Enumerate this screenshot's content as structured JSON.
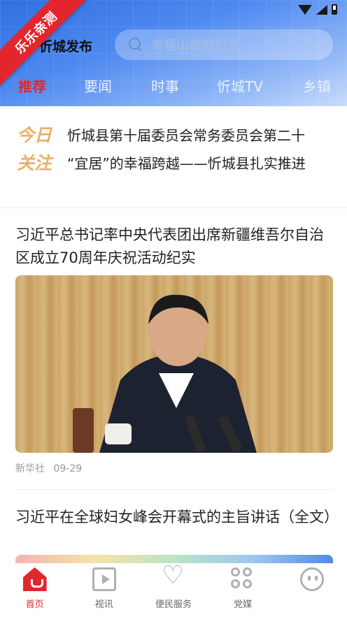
{
  "header": {
    "ribbon": "乐乐亲测",
    "logo_text": "忻城发布",
    "search_placeholder": "幸福山歌唱起来"
  },
  "tabs": [
    "推荐",
    "要闻",
    "时事",
    "忻城TV",
    "乡镇"
  ],
  "active_tab": "推荐",
  "today_focus": {
    "label_line1": "今日",
    "label_line2": "关注",
    "items": [
      "忻城县第十届委员会常务委员会第二十",
      "“宜居”的幸福跨越——忻城县扎实推进"
    ]
  },
  "articles": [
    {
      "title": "习近平总书记率中央代表团出席新疆维吾尔自治区成立70周年庆祝活动纪实",
      "source": "新华社",
      "date": "09-29"
    },
    {
      "title": "习近平在全球妇女峰会开幕式的主旨讲话（全文）"
    }
  ],
  "bottom_nav": [
    {
      "label": "首页",
      "icon": "home-icon",
      "active": true
    },
    {
      "label": "视讯",
      "icon": "video-icon",
      "active": false
    },
    {
      "label": "便民服务",
      "icon": "heart-hands-icon",
      "active": false
    },
    {
      "label": "党媒",
      "icon": "party-media-icon",
      "active": false
    },
    {
      "label": "",
      "icon": "smile-icon",
      "active": false
    }
  ],
  "colors": {
    "accent": "#e3262d",
    "header_blue": "#4f8af0",
    "today_gold": "#e8b06a"
  }
}
